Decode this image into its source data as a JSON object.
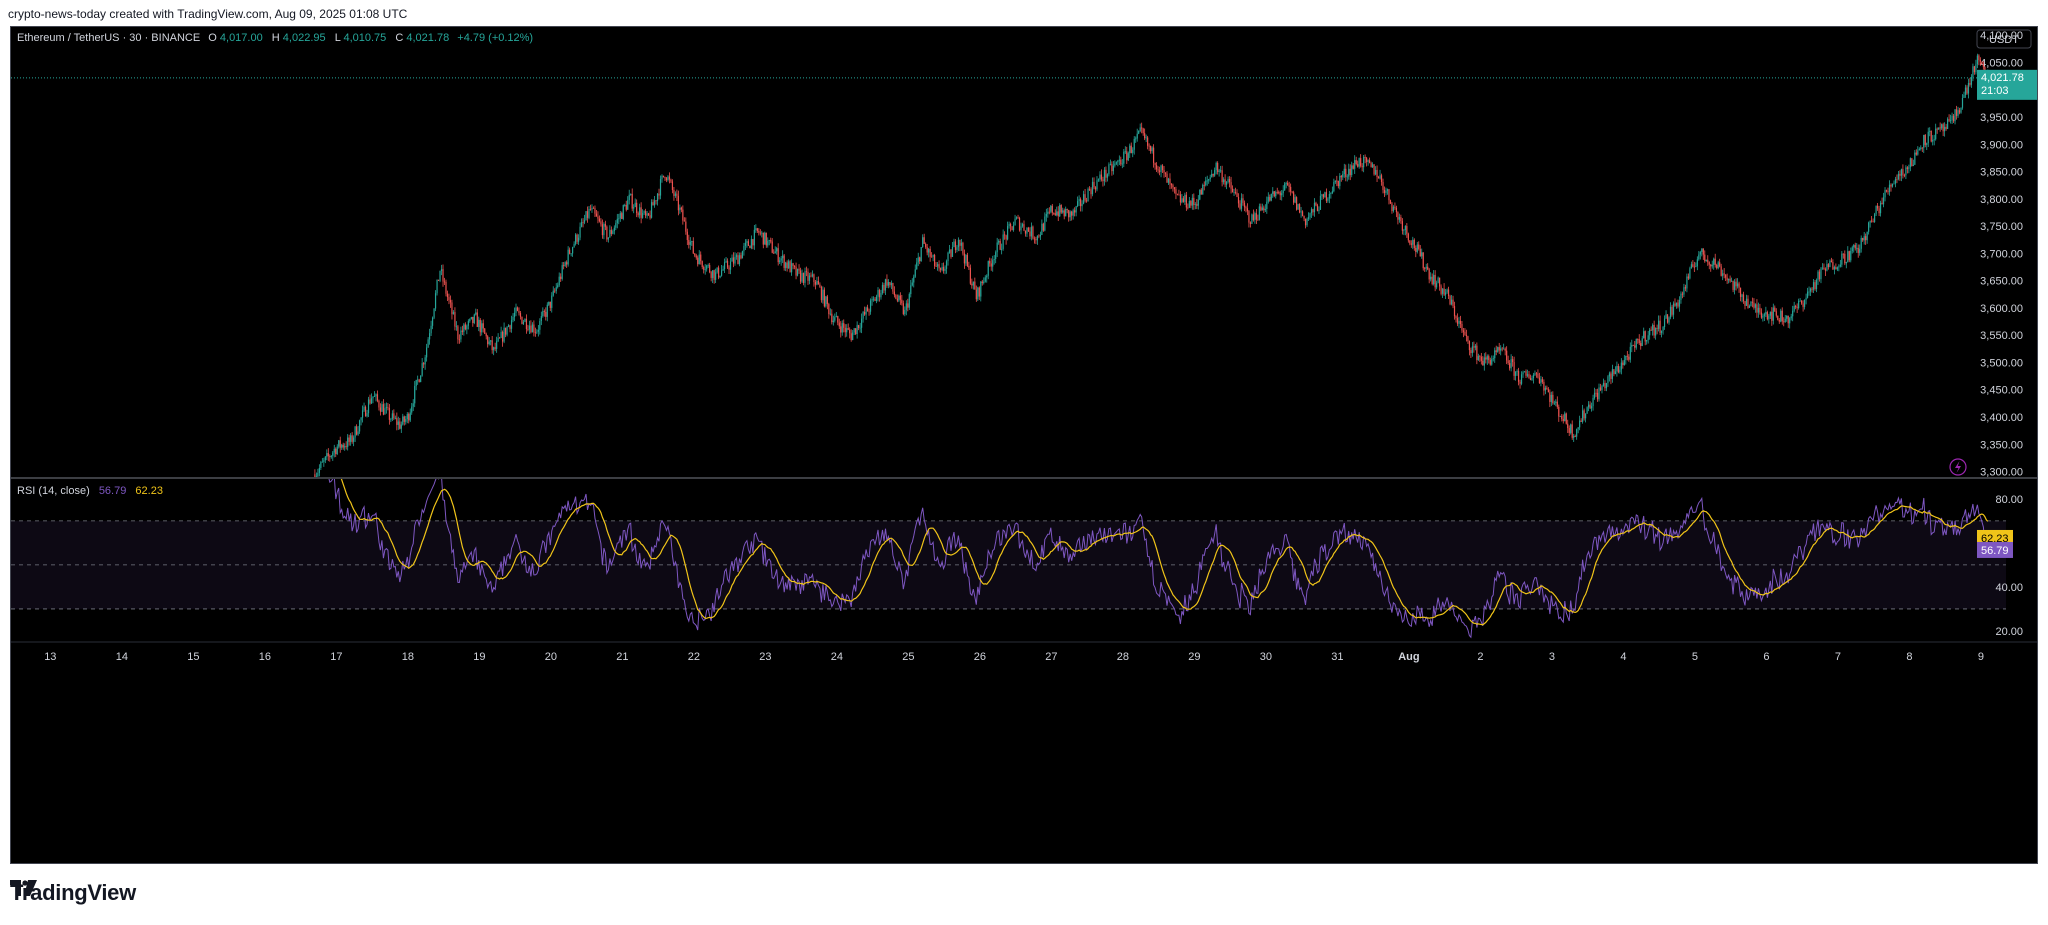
{
  "caption": "crypto-news-today created with TradingView.com, Aug 09, 2025 01:08 UTC",
  "brand": "TradingView",
  "header": {
    "title": "Ethereum / TetherUS · 30 · BINANCE",
    "o_label": "O",
    "o_value": "4,017.00",
    "h_label": "H",
    "h_value": "4,022.95",
    "l_label": "L",
    "l_value": "4,010.75",
    "c_label": "C",
    "c_value": "4,021.78",
    "change": "+4.79 (+0.12%)"
  },
  "currency": "USDT",
  "price_tag": {
    "price": "4,021.78",
    "countdown": "21:03"
  },
  "rsi_legend": {
    "label": "RSI (14, close)",
    "rsi": "56.79",
    "ma": "62.23"
  },
  "colors": {
    "background": "#000000",
    "up": "#26a69a",
    "down": "#ef5350",
    "rsi_line": "#7e57c2",
    "rsi_ma": "#f0c419",
    "text": "#d1d4dc",
    "price_tag": "#26a69a"
  },
  "chart_data": [
    {
      "type": "candlestick",
      "symbol": "ETH/USDT",
      "interval": "30",
      "exchange": "BINANCE",
      "y_ticks": [
        3300,
        3350,
        3400,
        3450,
        3500,
        3550,
        3600,
        3650,
        3700,
        3750,
        3800,
        3850,
        3900,
        3950,
        4000,
        4050,
        4100
      ],
      "y_tick_labels": [
        "3,300.00",
        "3,350.00",
        "3,400.00",
        "3,450.00",
        "3,500.00",
        "3,550.00",
        "3,600.00",
        "3,650.00",
        "3,700.00",
        "3,750.00",
        "3,800.00",
        "3,850.00",
        "3,900.00",
        "3,950.00",
        "4,000.00",
        "4,050.00",
        "4,100.00"
      ],
      "ylim": [
        3290,
        4115
      ],
      "x_labels": [
        "13",
        "14",
        "15",
        "16",
        "17",
        "18",
        "19",
        "20",
        "21",
        "22",
        "23",
        "24",
        "25",
        "26",
        "27",
        "28",
        "29",
        "30",
        "31",
        "Aug",
        "2",
        "3",
        "4",
        "5",
        "6",
        "7",
        "8",
        "9"
      ],
      "x_label_days": [
        13,
        14,
        15,
        16,
        17,
        18,
        19,
        20,
        21,
        22,
        23,
        24,
        25,
        26,
        27,
        28,
        29,
        30,
        31,
        32,
        33,
        34,
        35,
        36,
        37,
        38,
        39,
        40
      ],
      "x_range_days": [
        12.45,
        40.35
      ],
      "price_path_days": [
        16.7,
        17.0,
        17.2,
        17.5,
        17.75,
        17.9,
        18.0,
        18.25,
        18.45,
        18.7,
        18.95,
        19.2,
        19.5,
        19.8,
        20.0,
        20.25,
        20.55,
        20.8,
        21.1,
        21.35,
        21.6,
        21.8,
        22.0,
        22.3,
        22.6,
        22.9,
        23.15,
        23.45,
        23.7,
        23.95,
        24.2,
        24.45,
        24.7,
        24.95,
        25.2,
        25.45,
        25.7,
        25.95,
        26.2,
        26.5,
        26.8,
        27.0,
        27.3,
        27.55,
        27.8,
        28.05,
        28.25,
        28.5,
        28.75,
        29.0,
        29.3,
        29.55,
        29.8,
        30.05,
        30.3,
        30.55,
        30.8,
        31.05,
        31.3,
        31.55,
        31.8,
        32.05,
        32.3,
        32.55,
        32.8,
        33.05,
        33.3,
        33.55,
        33.8,
        34.05,
        34.3,
        34.55,
        34.8,
        35.05,
        35.3,
        35.55,
        35.8,
        36.05,
        36.3,
        36.55,
        36.8,
        37.05,
        37.3,
        37.55,
        37.8,
        38.05,
        38.3,
        38.55,
        38.8,
        39.0,
        39.2,
        39.4,
        39.6,
        39.8,
        39.95,
        40.0,
        40.05,
        40.1
      ],
      "price_path_values": [
        3295,
        3345,
        3355,
        3440,
        3400,
        3385,
        3400,
        3520,
        3670,
        3550,
        3580,
        3520,
        3590,
        3560,
        3610,
        3700,
        3780,
        3730,
        3800,
        3760,
        3850,
        3780,
        3700,
        3660,
        3690,
        3740,
        3700,
        3660,
        3650,
        3580,
        3550,
        3600,
        3650,
        3590,
        3720,
        3660,
        3730,
        3620,
        3700,
        3760,
        3730,
        3780,
        3770,
        3820,
        3850,
        3880,
        3920,
        3860,
        3800,
        3790,
        3860,
        3810,
        3760,
        3800,
        3820,
        3760,
        3800,
        3840,
        3870,
        3850,
        3780,
        3720,
        3660,
        3620,
        3540,
        3500,
        3520,
        3470,
        3480,
        3420,
        3370,
        3430,
        3470,
        3510,
        3550,
        3570,
        3620,
        3700,
        3680,
        3640,
        3600,
        3590,
        3580,
        3620,
        3670,
        3690,
        3710,
        3780,
        3840,
        3860,
        3910,
        3920,
        3940,
        4000,
        4055,
        4040,
        4030,
        4022
      ],
      "last_price": 4021.78
    },
    {
      "type": "line",
      "title": "RSI (14, close)",
      "y_ticks": [
        20,
        40,
        80
      ],
      "y_tick_labels": [
        "20.00",
        "40.00",
        "80.00"
      ],
      "ylim": [
        15,
        89
      ],
      "bands": [
        30,
        50,
        70
      ],
      "series": [
        {
          "name": "RSI",
          "last": 56.79
        },
        {
          "name": "RSI-based MA",
          "last": 62.23
        }
      ]
    }
  ]
}
